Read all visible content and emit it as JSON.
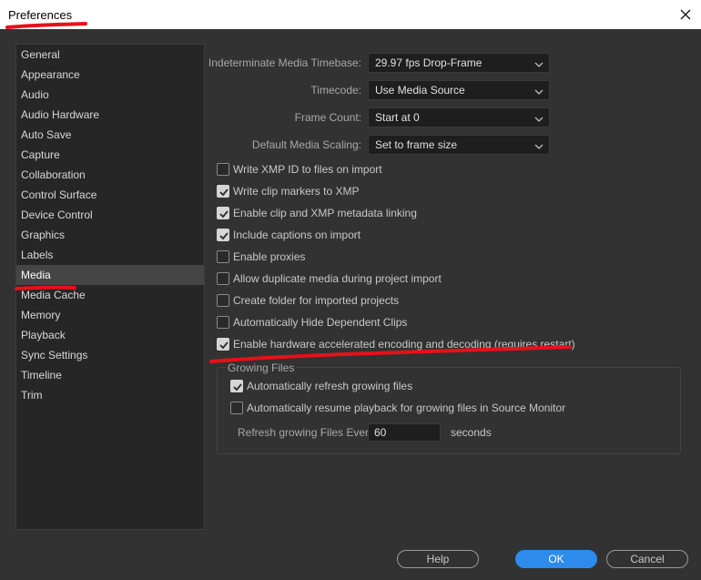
{
  "window": {
    "title": "Preferences",
    "close_icon": "close-icon"
  },
  "sidebar": {
    "items": [
      {
        "label": "General"
      },
      {
        "label": "Appearance"
      },
      {
        "label": "Audio"
      },
      {
        "label": "Audio Hardware"
      },
      {
        "label": "Auto Save"
      },
      {
        "label": "Capture"
      },
      {
        "label": "Collaboration"
      },
      {
        "label": "Control Surface"
      },
      {
        "label": "Device Control"
      },
      {
        "label": "Graphics"
      },
      {
        "label": "Labels"
      },
      {
        "label": "Media",
        "selected": true
      },
      {
        "label": "Media Cache"
      },
      {
        "label": "Memory"
      },
      {
        "label": "Playback"
      },
      {
        "label": "Sync Settings"
      },
      {
        "label": "Timeline"
      },
      {
        "label": "Trim"
      }
    ]
  },
  "dropdowns": [
    {
      "label": "Indeterminate Media Timebase:",
      "value": "29.97 fps Drop-Frame"
    },
    {
      "label": "Timecode:",
      "value": "Use Media Source"
    },
    {
      "label": "Frame Count:",
      "value": "Start at 0"
    },
    {
      "label": "Default Media Scaling:",
      "value": "Set to frame size"
    }
  ],
  "checkboxes": [
    {
      "label": "Write XMP ID to files on import",
      "checked": false
    },
    {
      "label": "Write clip markers to XMP",
      "checked": true
    },
    {
      "label": "Enable clip and XMP metadata linking",
      "checked": true
    },
    {
      "label": "Include captions on import",
      "checked": true
    },
    {
      "label": "Enable proxies",
      "checked": false
    },
    {
      "label": "Allow duplicate media during project import",
      "checked": false
    },
    {
      "label": "Create folder for imported projects",
      "checked": false
    },
    {
      "label": "Automatically Hide Dependent Clips",
      "checked": false
    },
    {
      "label": "Enable hardware accelerated encoding and decoding (requires restart)",
      "checked": true
    }
  ],
  "growing_files": {
    "title": "Growing Files",
    "options": [
      {
        "label": "Automatically refresh growing files",
        "checked": true
      },
      {
        "label": "Automatically resume playback for growing files in Source Monitor",
        "checked": false
      }
    ],
    "refresh_label": "Refresh growing Files Every",
    "refresh_value": "60",
    "refresh_unit": "seconds"
  },
  "buttons": {
    "help": "Help",
    "ok": "OK",
    "cancel": "Cancel"
  },
  "colors": {
    "accent": "#2d8ceb",
    "annotation": "#e8101a",
    "background": "#323232"
  }
}
